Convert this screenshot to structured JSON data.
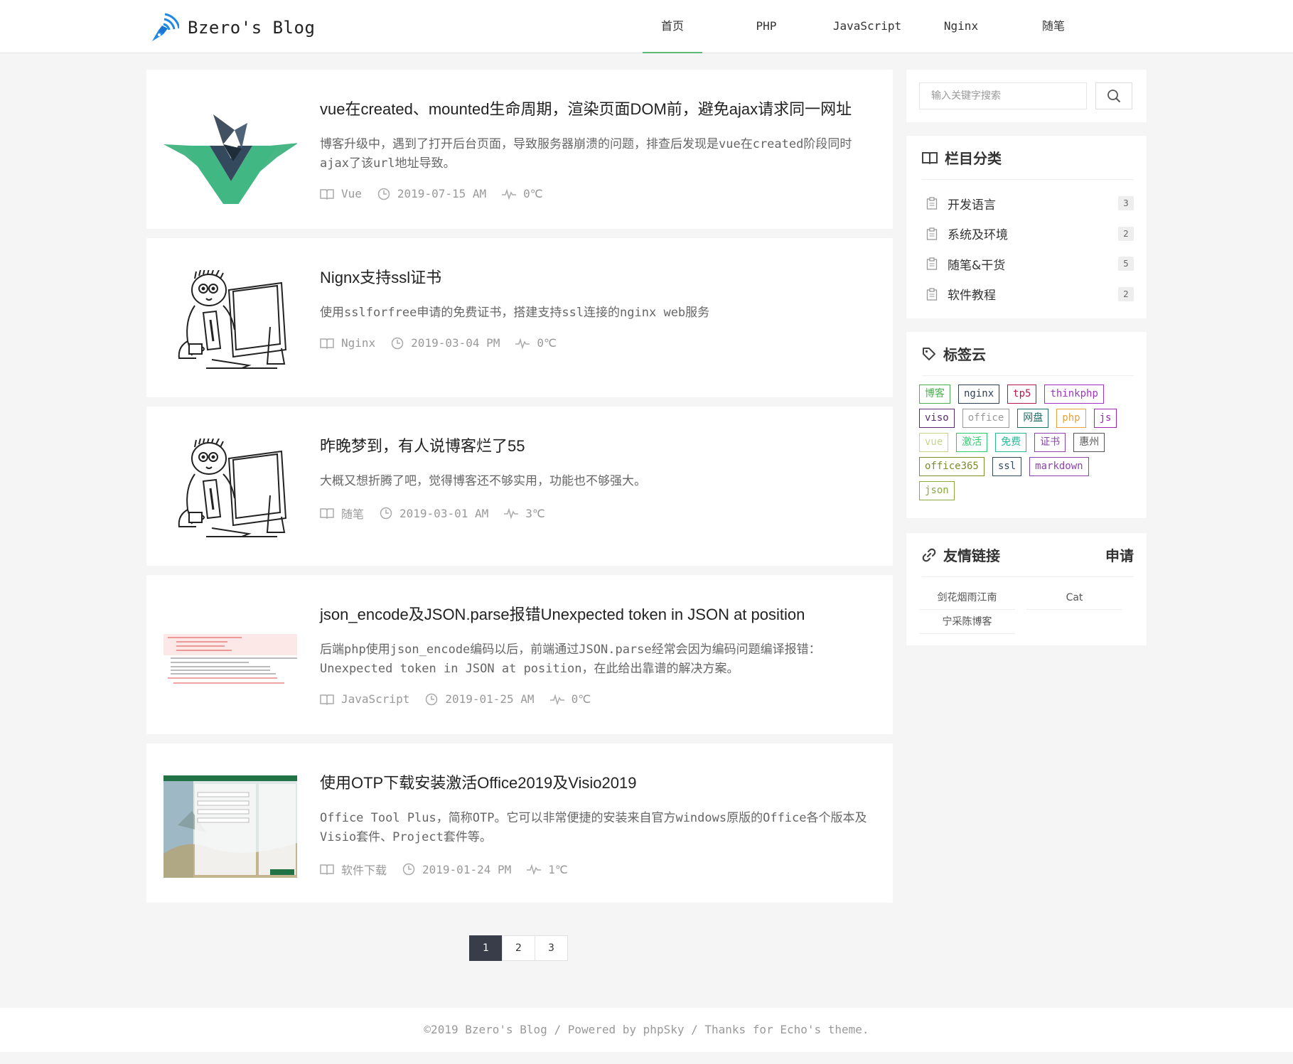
{
  "header": {
    "site_name": "Bzero's Blog",
    "nav": [
      {
        "label": "首页",
        "active": true
      },
      {
        "label": "PHP",
        "active": false
      },
      {
        "label": "JavaScript",
        "active": false
      },
      {
        "label": "Nginx",
        "active": false
      },
      {
        "label": "随笔",
        "active": false
      }
    ]
  },
  "posts": [
    {
      "title": "vue在created、mounted生命周期，渲染页面DOM前，避免ajax请求同一网址",
      "excerpt": "博客升级中，遇到了打开后台页面，导致服务器崩溃的问题，排查后发现是vue在created阶段同时ajax了该url地址导致。",
      "category": "Vue",
      "date": "2019-07-15 AM",
      "temp": "0℃",
      "thumb": "vue-logo"
    },
    {
      "title": "Nignx支持ssl证书",
      "excerpt": "使用sslforfree申请的免费证书，搭建支持ssl连接的nginx web服务",
      "category": "Nginx",
      "date": "2019-03-04 PM",
      "temp": "0℃",
      "thumb": "cartoon-programmer"
    },
    {
      "title": "昨晚梦到，有人说博客烂了55",
      "excerpt": "大概又想折腾了吧，觉得博客还不够实用，功能也不够强大。",
      "category": "随笔",
      "date": "2019-03-01 AM",
      "temp": "3℃",
      "thumb": "cartoon-programmer"
    },
    {
      "title": "json_encode及JSON.parse报错Unexpected token in JSON at position",
      "excerpt": "后端php使用json_encode编码以后，前端通过JSON.parse经常会因为编码问题编译报错：Unexpected token in JSON at position，在此给出靠谱的解决方案。",
      "category": "JavaScript",
      "date": "2019-01-25 AM",
      "temp": "0℃",
      "thumb": "console-error"
    },
    {
      "title": "使用OTP下载安装激活Office2019及Visio2019",
      "excerpt": "Office Tool Plus，简称OTP。它可以非常便捷的安装来自官方windows原版的Office各个版本及Visio套件、Project套件等。",
      "category": "软件下载",
      "date": "2019-01-24 PM",
      "temp": "1℃",
      "thumb": "office-tool-window"
    }
  ],
  "pagination": {
    "pages": [
      "1",
      "2",
      "3"
    ],
    "current": "1"
  },
  "search": {
    "placeholder": "输入关键字搜索"
  },
  "categories": {
    "title": "栏目分类",
    "items": [
      {
        "label": "开发语言",
        "count": "3"
      },
      {
        "label": "系统及环境",
        "count": "2"
      },
      {
        "label": "随笔&干货",
        "count": "5"
      },
      {
        "label": "软件教程",
        "count": "2"
      }
    ]
  },
  "tags": {
    "title": "标签云",
    "items": [
      {
        "label": "博客",
        "color": "#4CAF50"
      },
      {
        "label": "nginx",
        "color": "#2F4056"
      },
      {
        "label": "tp5",
        "color": "#B5174F"
      },
      {
        "label": "thinkphp",
        "color": "#A233C6"
      },
      {
        "label": "viso",
        "color": "#5B2C6F"
      },
      {
        "label": "office",
        "color": "#999999"
      },
      {
        "label": "网盘",
        "color": "#1E6E6A"
      },
      {
        "label": "php",
        "color": "#E6A23C"
      },
      {
        "label": "js",
        "color": "#9C27B0"
      },
      {
        "label": "vue",
        "color": "#C5D68A"
      },
      {
        "label": "激活",
        "color": "#2ECC71"
      },
      {
        "label": "免费",
        "color": "#26B99A"
      },
      {
        "label": "证书",
        "color": "#8E44AD"
      },
      {
        "label": "惠州",
        "color": "#555555"
      },
      {
        "label": "office365",
        "color": "#7F8C2D"
      },
      {
        "label": "ssl",
        "color": "#34495E"
      },
      {
        "label": "markdown",
        "color": "#8E44AD"
      },
      {
        "label": "json",
        "color": "#8BAA3A"
      }
    ]
  },
  "links": {
    "title": "友情链接",
    "apply": "申请",
    "items": [
      "剑花烟雨江南",
      "Cat",
      "宁采陈博客"
    ]
  },
  "footer": {
    "text": "©2019 Bzero's Blog / Powered by phpSky / Thanks for Echo's theme."
  }
}
